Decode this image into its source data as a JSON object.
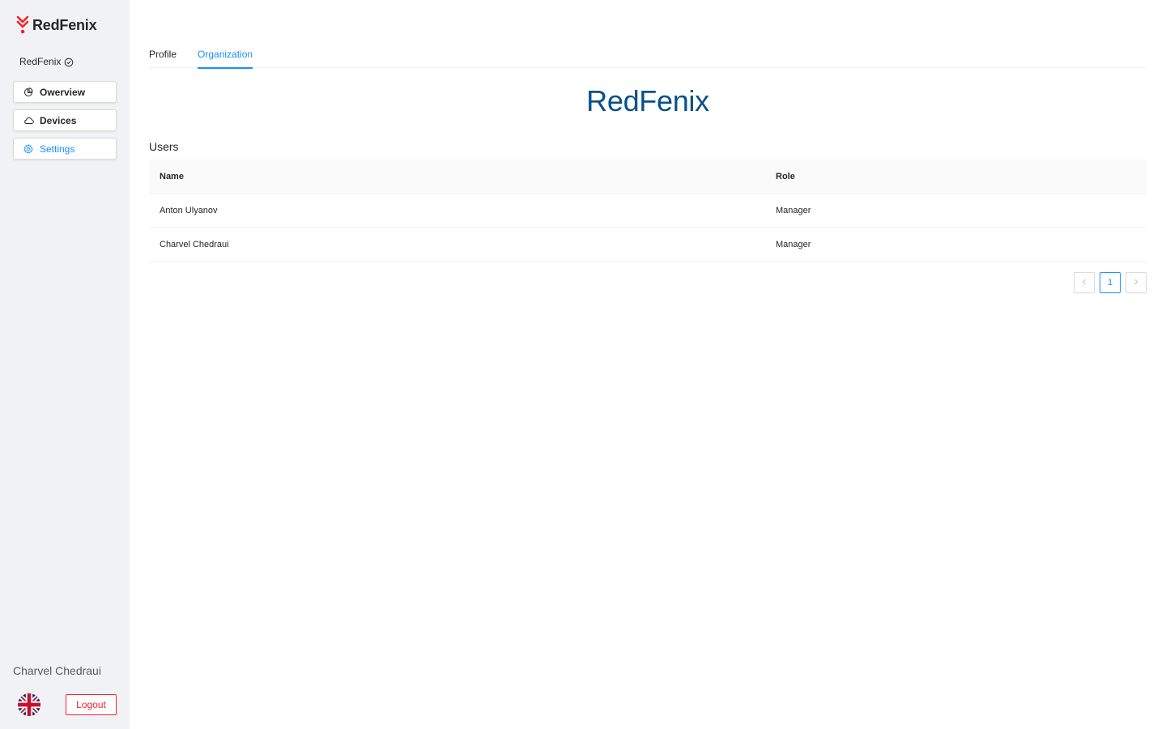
{
  "app": {
    "brand_name": "RedFenix",
    "brand_color": "#f5222d"
  },
  "sidebar": {
    "org_name": "RedFenix",
    "nav": [
      {
        "label": "Owerview",
        "icon": "pie-chart-icon"
      },
      {
        "label": "Devices",
        "icon": "cloud-icon"
      },
      {
        "label": "Settings",
        "icon": "gear-icon",
        "active": true
      }
    ],
    "user_name": "Charvel Chedraui",
    "language_icon": "uk-flag-icon",
    "logout_label": "Logout"
  },
  "main": {
    "tabs": [
      {
        "label": "Profile"
      },
      {
        "label": "Organization",
        "active": true
      }
    ],
    "org_title": "RedFenix",
    "users_section_title": "Users",
    "table": {
      "columns": [
        "Name",
        "Role"
      ],
      "rows": [
        {
          "name": "Anton Ulyanov",
          "role": "Manager"
        },
        {
          "name": "Charvel Chedraui",
          "role": "Manager"
        }
      ]
    },
    "pagination": {
      "prev_icon": "chevron-left-icon",
      "current_page": "1",
      "next_icon": "chevron-right-icon"
    }
  },
  "colors": {
    "accent": "#1890ff",
    "title": "#0a5087",
    "danger": "#f5222d",
    "sidebar_bg": "#f0f2f5"
  }
}
